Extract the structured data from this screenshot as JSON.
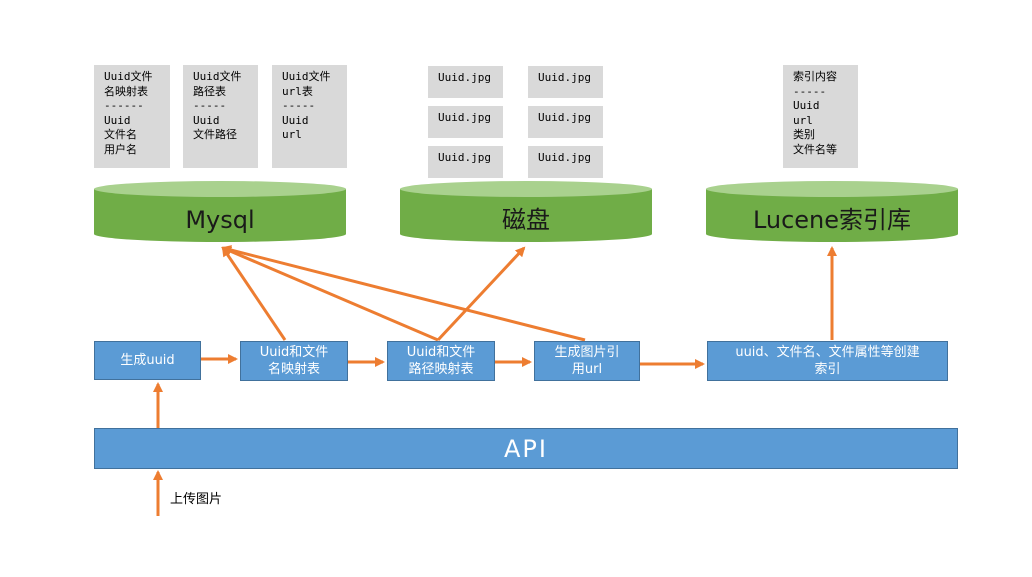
{
  "cards": [
    {
      "lines": [
        "Uuid文件",
        "名映射表",
        "------",
        "Uuid",
        "文件名",
        "用户名"
      ]
    },
    {
      "lines": [
        "Uuid文件",
        "路径表",
        "-----",
        "Uuid",
        "文件路径"
      ]
    },
    {
      "lines": [
        "Uuid文件",
        "url表",
        "-----",
        "Uuid",
        "url"
      ]
    },
    {
      "lines": [
        "索引内容",
        "-----",
        "Uuid",
        "url",
        "类别",
        "文件名等"
      ]
    }
  ],
  "images": [
    "Uuid.jpg",
    "Uuid.jpg",
    "Uuid.jpg",
    "Uuid.jpg",
    "Uuid.jpg",
    "Uuid.jpg"
  ],
  "databases": {
    "mysql": "Mysql",
    "disk": "磁盘",
    "lucene": "Lucene索引库"
  },
  "process": {
    "gen_uuid": [
      "生成uuid"
    ],
    "name_map": [
      "Uuid和文件",
      "名映射表"
    ],
    "path_map": [
      "Uuid和文件",
      "路径映射表"
    ],
    "gen_url": [
      "生成图片引",
      "用url"
    ],
    "index": [
      "uuid、文件名、文件属性等创建",
      "索引"
    ]
  },
  "api_label": "API",
  "upload_label": "上传图片",
  "colors": {
    "box_fill": "#5b9bd5",
    "arrow": "#ed7d31",
    "db_fill": "#70ad47",
    "card_fill": "#d9d9d9"
  }
}
